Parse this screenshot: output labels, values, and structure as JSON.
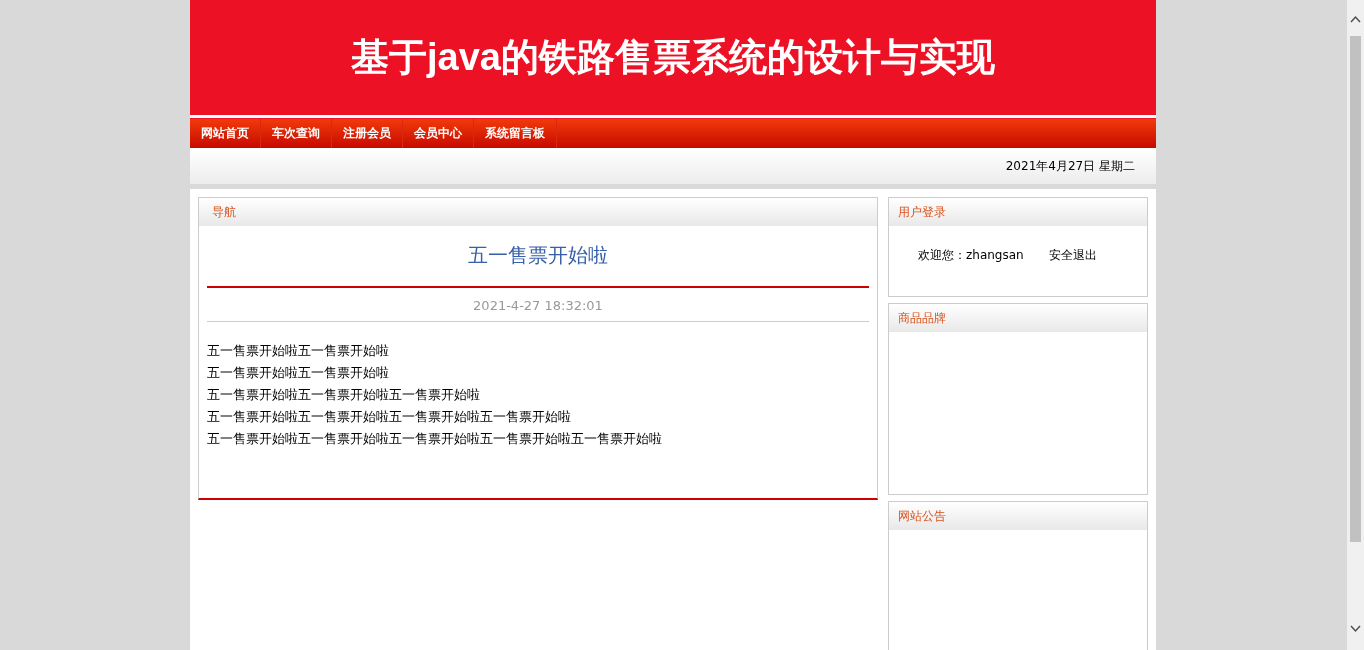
{
  "header": {
    "title": "基于java的铁路售票系统的设计与实现"
  },
  "nav": [
    {
      "label": "网站首页"
    },
    {
      "label": "车次查询"
    },
    {
      "label": "注册会员"
    },
    {
      "label": "会员中心"
    },
    {
      "label": "系统留言板"
    }
  ],
  "date_bar": {
    "text": "2021年4月27日 星期二"
  },
  "main_panel": {
    "title": "导航",
    "article": {
      "headline": "五一售票开始啦",
      "time": "2021-4-27 18:32:01",
      "lines": [
        "五一售票开始啦五一售票开始啦",
        "五一售票开始啦五一售票开始啦",
        "五一售票开始啦五一售票开始啦五一售票开始啦",
        "五一售票开始啦五一售票开始啦五一售票开始啦五一售票开始啦",
        "五一售票开始啦五一售票开始啦五一售票开始啦五一售票开始啦五一售票开始啦"
      ]
    }
  },
  "sidebar": [
    {
      "title": "用户登录",
      "kind": "login",
      "welcome": "欢迎您：zhangsan",
      "logout": "安全退出"
    },
    {
      "title": "商品品牌",
      "kind": "empty"
    },
    {
      "title": "网站公告",
      "kind": "empty"
    }
  ]
}
